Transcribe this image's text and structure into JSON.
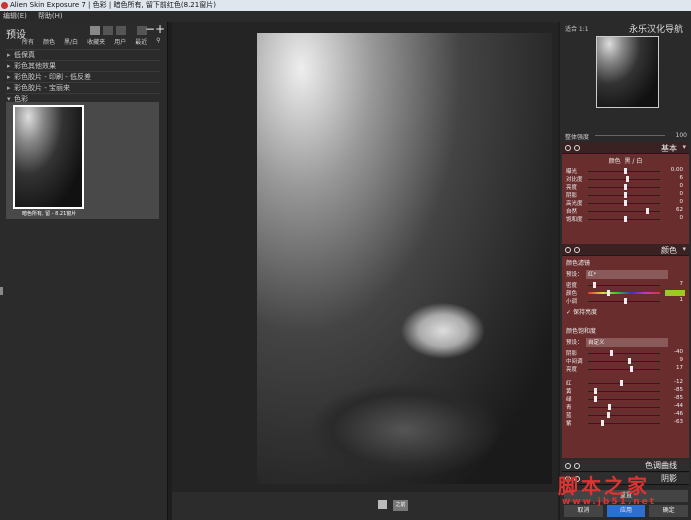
{
  "window": {
    "title": "Alien Skin Exposure 7 | 色彩 | 暗色所有, 留下前红色(8.21窗片)"
  },
  "menu": [
    "编辑(E)",
    "帮助(H)"
  ],
  "left": {
    "title": "预设",
    "tabs": [
      "所有",
      "颜色",
      "黑/白",
      "收藏夹",
      "用户",
      "最近"
    ],
    "groups": [
      "低保真",
      "彩色其他效果",
      "彩色胶片 - 印刷 - 低反差",
      "彩色胶片 - 宝丽来",
      "色彩"
    ],
    "thumb_caption": "暗色所有, 留 - 8.21窗片"
  },
  "center": {
    "before_label": "之前"
  },
  "right": {
    "zoom_label": "适合 1:1",
    "navigator_title": "永乐汉化导航",
    "strength_label": "整体强度",
    "strength_value": "100",
    "basic": {
      "title": "基本",
      "tabs": [
        "颜色",
        "黑 / 白"
      ],
      "sliders": [
        {
          "label": "曝光",
          "value": "0.00",
          "pos": 0.5
        },
        {
          "label": "对比度",
          "value": "6",
          "pos": 0.53
        },
        {
          "label": "亮度",
          "value": "0",
          "pos": 0.5
        },
        {
          "label": "阴影",
          "value": "0",
          "pos": 0.5
        },
        {
          "label": "高光度",
          "value": "0",
          "pos": 0.5
        },
        {
          "label": "自然",
          "value": "62",
          "pos": 0.81
        },
        {
          "label": "饱和度",
          "value": "0",
          "pos": 0.5
        }
      ]
    },
    "color": {
      "title": "颜色",
      "filter_title": "颜色滤镜",
      "preset_label": "预设：",
      "filter_preset": "红*",
      "filter_sliders": [
        {
          "label": "密度",
          "value": "7",
          "pos": 0.07
        },
        {
          "label": "颜色",
          "value": "",
          "pos": 0.27
        },
        {
          "label": "小调",
          "value": "1",
          "pos": 0.5
        }
      ],
      "preserve_label": "保持亮度",
      "sat_title": "颜色饱和度",
      "sat_preset": "自定义",
      "tone_sliders": [
        {
          "label": "阴影",
          "value": "-40",
          "pos": 0.3
        },
        {
          "label": "中间调",
          "value": "9",
          "pos": 0.55
        },
        {
          "label": "亮度",
          "value": "17",
          "pos": 0.58
        }
      ],
      "hue_sliders": [
        {
          "label": "红",
          "value": "-12",
          "pos": 0.44
        },
        {
          "label": "黄",
          "value": "-85",
          "pos": 0.08
        },
        {
          "label": "绿",
          "value": "-85",
          "pos": 0.08
        },
        {
          "label": "青",
          "value": "-44",
          "pos": 0.28
        },
        {
          "label": "蓝",
          "value": "-46",
          "pos": 0.27
        },
        {
          "label": "紫",
          "value": "-63",
          "pos": 0.18
        }
      ]
    },
    "collapsed": [
      "色调曲线",
      "阴影"
    ],
    "buttons": [
      "重置",
      "取消",
      "应用",
      "确定"
    ]
  },
  "watermark": {
    "text": "脚本之家",
    "url": "www.jb51.net"
  },
  "colors": {
    "panel": "#6a2d2d",
    "accent": "#2d6fd1"
  }
}
